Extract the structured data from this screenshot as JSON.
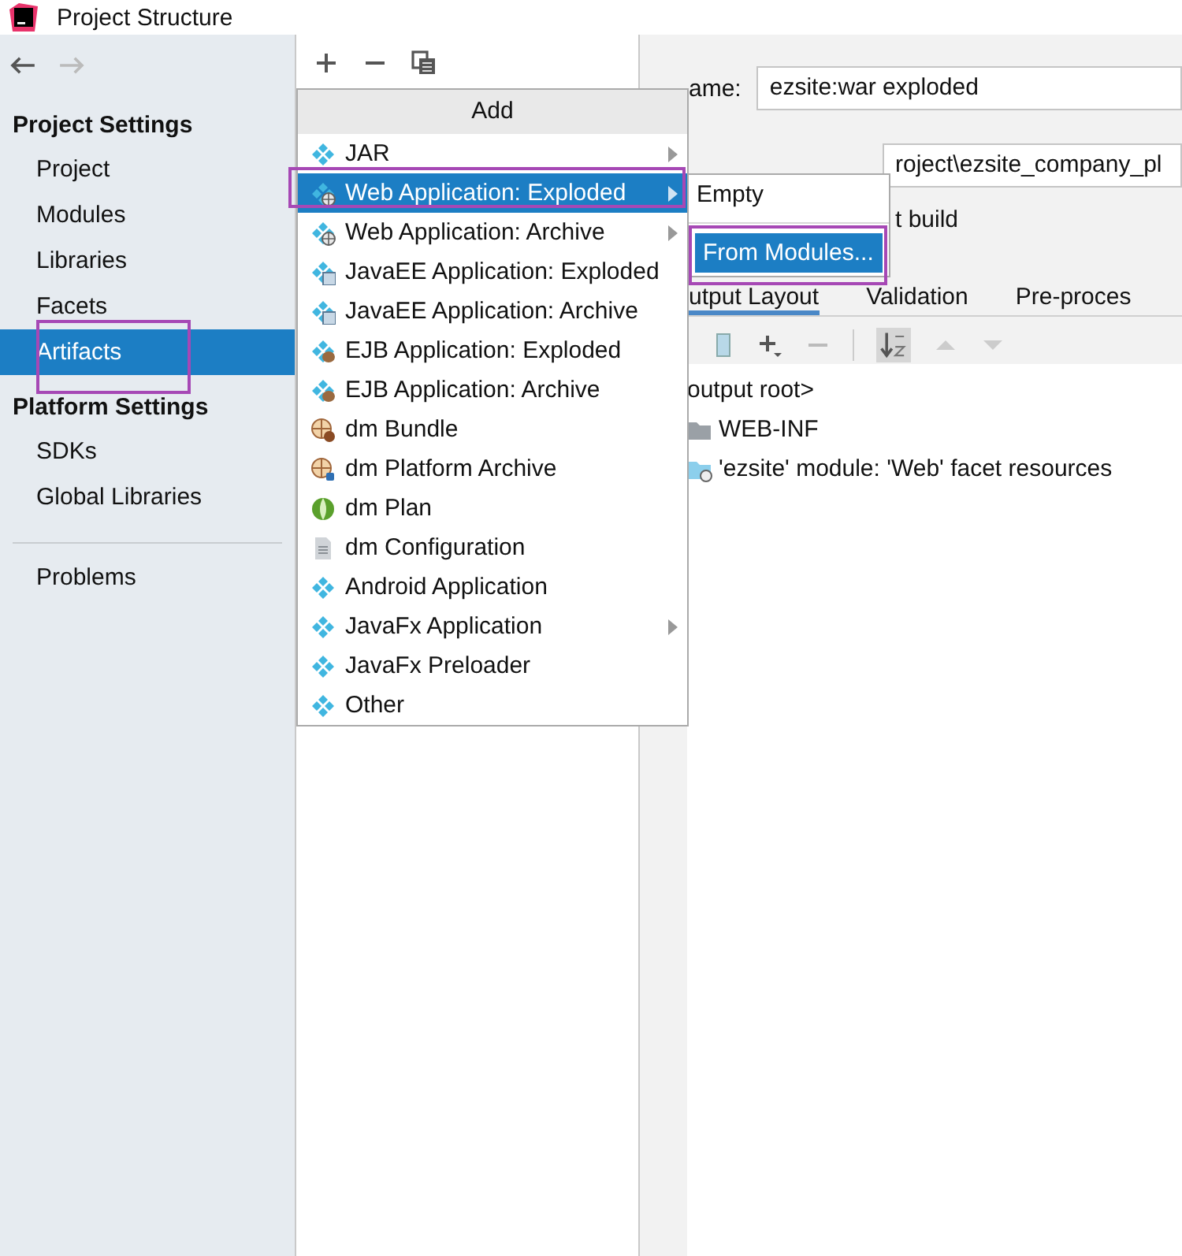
{
  "window": {
    "title": "Project Structure"
  },
  "sidebar": {
    "sections": [
      {
        "heading": "Project Settings",
        "items": [
          {
            "label": "Project",
            "selected": false
          },
          {
            "label": "Modules",
            "selected": false
          },
          {
            "label": "Libraries",
            "selected": false
          },
          {
            "label": "Facets",
            "selected": false
          },
          {
            "label": "Artifacts",
            "selected": true
          }
        ]
      },
      {
        "heading": "Platform Settings",
        "items": [
          {
            "label": "SDKs",
            "selected": false
          },
          {
            "label": "Global Libraries",
            "selected": false
          }
        ]
      }
    ],
    "bottom_items": [
      {
        "label": "Problems",
        "selected": false
      }
    ]
  },
  "add_menu": {
    "title": "Add",
    "items": [
      {
        "label": "JAR",
        "kind": "plain",
        "selected": false,
        "has_submenu": true
      },
      {
        "label": "Web Application: Exploded",
        "kind": "web",
        "selected": true,
        "has_submenu": true
      },
      {
        "label": "Web Application: Archive",
        "kind": "web",
        "selected": false,
        "has_submenu": true
      },
      {
        "label": "JavaEE Application: Exploded",
        "kind": "ee",
        "selected": false,
        "has_submenu": false
      },
      {
        "label": "JavaEE Application: Archive",
        "kind": "ee",
        "selected": false,
        "has_submenu": false
      },
      {
        "label": "EJB Application: Exploded",
        "kind": "ejb",
        "selected": false,
        "has_submenu": false
      },
      {
        "label": "EJB Application: Archive",
        "kind": "ejb",
        "selected": false,
        "has_submenu": false
      },
      {
        "label": "dm Bundle",
        "kind": "bundle",
        "selected": false,
        "has_submenu": false
      },
      {
        "label": "dm Platform Archive",
        "kind": "platform",
        "selected": false,
        "has_submenu": false
      },
      {
        "label": "dm Plan",
        "kind": "plan",
        "selected": false,
        "has_submenu": false
      },
      {
        "label": "dm Configuration",
        "kind": "config",
        "selected": false,
        "has_submenu": false
      },
      {
        "label": "Android Application",
        "kind": "plain",
        "selected": false,
        "has_submenu": false
      },
      {
        "label": "JavaFx Application",
        "kind": "plain",
        "selected": false,
        "has_submenu": true
      },
      {
        "label": "JavaFx Preloader",
        "kind": "plain",
        "selected": false,
        "has_submenu": false
      },
      {
        "label": "Other",
        "kind": "plain",
        "selected": false,
        "has_submenu": false
      }
    ]
  },
  "submenu": {
    "items": [
      {
        "label": "Empty",
        "selected": false
      },
      {
        "label": "From Modules...",
        "selected": true
      }
    ]
  },
  "artifact": {
    "name_label": "ame:",
    "name_value": "ezsite:war exploded",
    "output_directory_value": "roject\\ezsite_company_pl",
    "build_label": "t build",
    "tabs": [
      {
        "label": "utput Layout",
        "selected": true
      },
      {
        "label": "Validation",
        "selected": false
      },
      {
        "label": "Pre-proces",
        "selected": false
      }
    ],
    "tree": [
      {
        "label": "output root>",
        "children": [
          {
            "label": "WEB-INF",
            "kind": "folder"
          },
          {
            "label": "'ezsite' module: 'Web' facet resources",
            "kind": "web"
          }
        ]
      }
    ]
  }
}
